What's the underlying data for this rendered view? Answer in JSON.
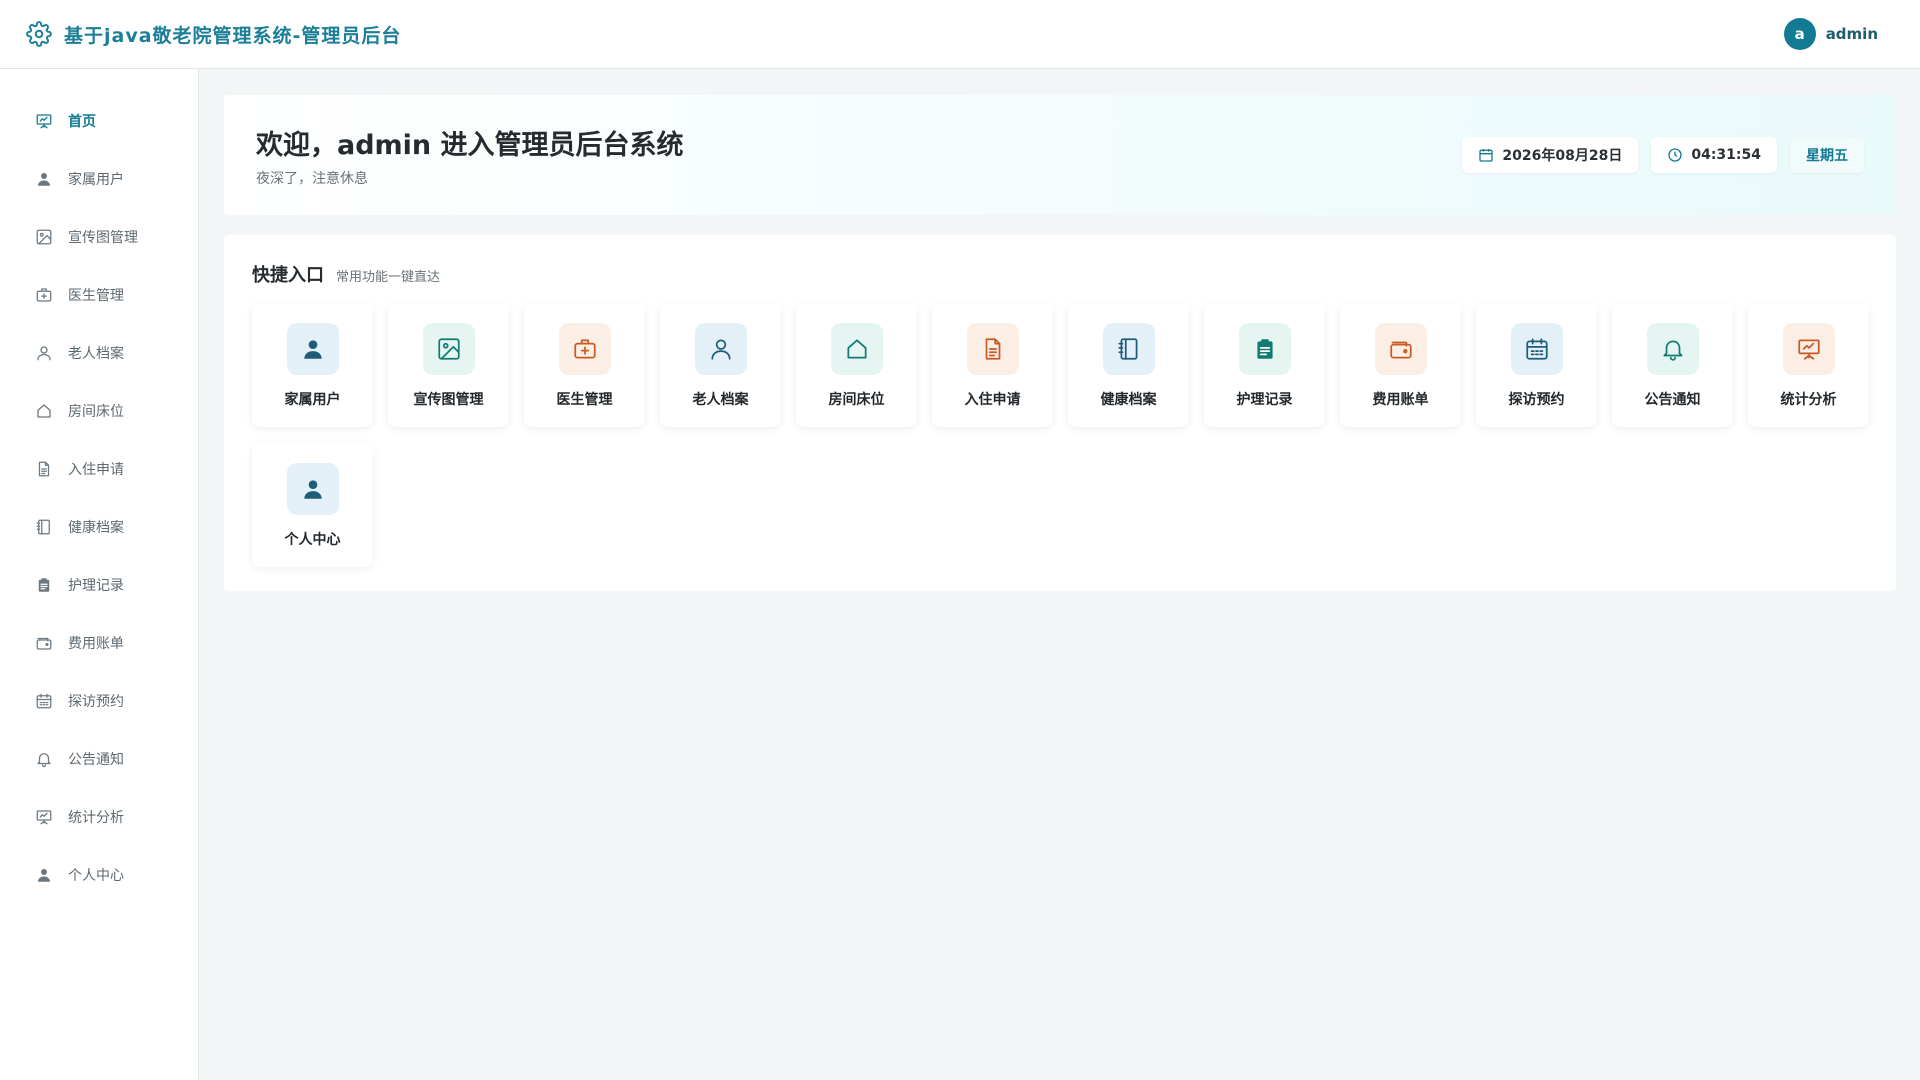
{
  "header": {
    "brand_icon": "gear-icon",
    "title": "基于java敬老院管理系统-管理员后台",
    "avatar_letter": "a",
    "username": "admin"
  },
  "sidebar": {
    "items": [
      {
        "label": "首页",
        "icon": "presentation-icon",
        "active": true
      },
      {
        "label": "家属用户",
        "icon": "person-icon"
      },
      {
        "label": "宣传图管理",
        "icon": "image-icon"
      },
      {
        "label": "医生管理",
        "icon": "medical-kit-icon"
      },
      {
        "label": "老人档案",
        "icon": "person-outline-icon"
      },
      {
        "label": "房间床位",
        "icon": "house-icon"
      },
      {
        "label": "入住申请",
        "icon": "document-icon"
      },
      {
        "label": "健康档案",
        "icon": "notebook-icon"
      },
      {
        "label": "护理记录",
        "icon": "clipboard-icon"
      },
      {
        "label": "费用账单",
        "icon": "wallet-icon"
      },
      {
        "label": "探访预约",
        "icon": "calendar-icon"
      },
      {
        "label": "公告通知",
        "icon": "bell-icon"
      },
      {
        "label": "统计分析",
        "icon": "presentation-icon"
      },
      {
        "label": "个人中心",
        "icon": "person-icon"
      }
    ]
  },
  "welcome": {
    "title": "欢迎，admin 进入管理员后台系统",
    "subtitle": "夜深了，注意休息",
    "date": "2026年08月28日",
    "time": "04:31:54",
    "weekday": "星期五"
  },
  "quick": {
    "title": "快捷入口",
    "subtitle": "常用功能一键直达",
    "items": [
      {
        "label": "家属用户",
        "icon": "person-icon",
        "tone": "blue"
      },
      {
        "label": "宣传图管理",
        "icon": "image-icon",
        "tone": "green"
      },
      {
        "label": "医生管理",
        "icon": "medical-kit-icon",
        "tone": "orange"
      },
      {
        "label": "老人档案",
        "icon": "person-outline-icon",
        "tone": "blue"
      },
      {
        "label": "房间床位",
        "icon": "house-icon",
        "tone": "green"
      },
      {
        "label": "入住申请",
        "icon": "document-icon",
        "tone": "orange"
      },
      {
        "label": "健康档案",
        "icon": "notebook-icon",
        "tone": "blue"
      },
      {
        "label": "护理记录",
        "icon": "clipboard-icon",
        "tone": "green"
      },
      {
        "label": "费用账单",
        "icon": "wallet-icon",
        "tone": "orange"
      },
      {
        "label": "探访预约",
        "icon": "calendar-icon",
        "tone": "blue"
      },
      {
        "label": "公告通知",
        "icon": "bell-icon",
        "tone": "green"
      },
      {
        "label": "统计分析",
        "icon": "presentation-icon",
        "tone": "orange"
      },
      {
        "label": "个人中心",
        "icon": "person-icon",
        "tone": "blue"
      }
    ]
  },
  "colors": {
    "primary": "#137a93",
    "brand_text": "#1c7f98",
    "icon_blue": "#1d5d78",
    "icon_green": "#137a73",
    "icon_orange": "#c85a26",
    "sidebar_icon": "#6b7880"
  }
}
